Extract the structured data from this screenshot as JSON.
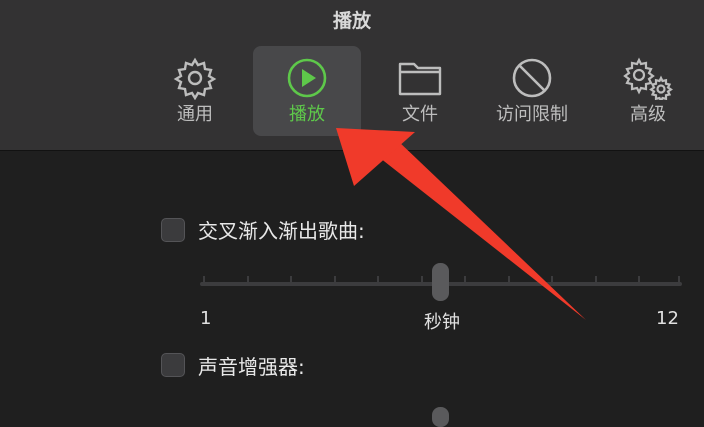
{
  "window": {
    "title": "播放"
  },
  "tabs": [
    {
      "key": "general",
      "label": "通用",
      "icon": "gear-icon"
    },
    {
      "key": "playback",
      "label": "播放",
      "icon": "play-circle-icon",
      "active": true
    },
    {
      "key": "files",
      "label": "文件",
      "icon": "folder-icon"
    },
    {
      "key": "restrictions",
      "label": "访问限制",
      "icon": "prohibited-icon"
    },
    {
      "key": "advanced",
      "label": "高级",
      "icon": "gears-icon"
    }
  ],
  "settings": {
    "crossfade": {
      "label": "交叉渐入渐出歌曲:",
      "checked": false,
      "slider": {
        "min_label": "1",
        "unit_label": "秒钟",
        "max_label": "12"
      }
    },
    "sound_enhancer": {
      "label": "声音增强器:",
      "checked": false
    }
  },
  "colors": {
    "accent": "#5ec84a",
    "annotation_arrow": "#f03a2a"
  }
}
